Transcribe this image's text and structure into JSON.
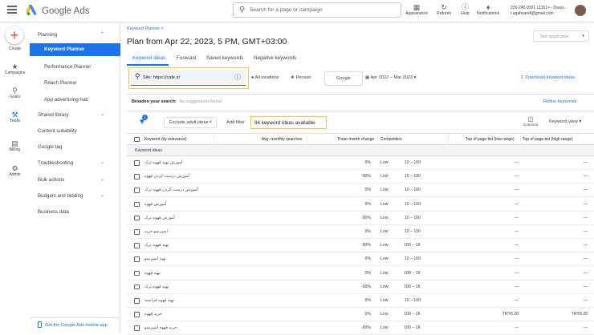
{
  "app": {
    "title": "Google Ads"
  },
  "search": {
    "placeholder": "Search for a page or campaign"
  },
  "toolbar": {
    "appearance": "Appearance",
    "refresh": "Refresh",
    "help": "Help",
    "notifications": "Notifications"
  },
  "account": {
    "id": "226-245-9321 L1151+ - Darex...",
    "email": "t.aqahvandi@gmail.com"
  },
  "rail": {
    "create": "Create",
    "campaigns": "Campaigns",
    "goals": "Goals",
    "tools": "Tools",
    "billing": "Billing",
    "admin": "Admin"
  },
  "sidebar": {
    "planning": "Planning",
    "keyword_planner": "Keyword Planner",
    "performance_planner": "Performance Planner",
    "reach_planner": "Reach Planner",
    "app_advertising_hub": "App advertising hub",
    "shared_library": "Shared library",
    "content_suitability": "Content suitability",
    "google_tag": "Google tag",
    "troubleshooting": "Troubleshooting",
    "bulk_actions": "Bulk actions",
    "budgets_and_bidding": "Budgets and bidding",
    "business_data": "Business data",
    "mobile_app": "Get the Google Ads mobile app"
  },
  "page": {
    "breadcrumb": "Keyword Planner >",
    "title": "Plan from Apr 22, 2023, 5 PM, GMT+03:00",
    "not_applicable": "Not applicable"
  },
  "tabs": {
    "keyword_ideas": "Keyword ideas",
    "forecast": "Forecast",
    "saved_keywords": "Saved keywords",
    "negative_keywords": "Negative keywords"
  },
  "filters": {
    "site": "Site: https://cafe.ir/",
    "locations": "All locations",
    "language": "Persian",
    "network": "Google",
    "date_range": "Apr 2022 – Mar 2023",
    "download": "Download keyword ideas"
  },
  "broaden": {
    "label": "Broaden your search:",
    "value": "No suggestions found",
    "refine": "Refine keywords"
  },
  "tablebar": {
    "filter_count": "1",
    "exclude_chip": "Exclude adult ideas",
    "add_filter": "Add filter",
    "available": "94 keyword ideas available",
    "columns": "Columns",
    "keyword_view": "Keyword view"
  },
  "table": {
    "headers": {
      "keyword": "Keyword (by relevance)",
      "searches": "Avg. monthly searches",
      "change": "Three month change",
      "competition": "Competition",
      "bid_low": "Top of page bid (low range)",
      "bid_high": "Top of page bid (high range)"
    },
    "group": "Keyword ideas",
    "rows": [
      {
        "kw": "آموزش تهیه قهوه ترک",
        "s": "10 – 100",
        "c": "0%",
        "comp": "Low",
        "lo": "—",
        "hi": "—"
      },
      {
        "kw": "آموزش درست کردن قهوه",
        "s": "10 – 100",
        "c": "-90%",
        "comp": "Low",
        "lo": "—",
        "hi": "—"
      },
      {
        "kw": "آموزش درست کردن قهوه ترک",
        "s": "10 – 100",
        "c": "0%",
        "comp": "Low",
        "lo": "—",
        "hi": "—"
      },
      {
        "kw": "آموزش قهوه",
        "s": "10 – 100",
        "c": "0%",
        "comp": "Low",
        "lo": "—",
        "hi": "—"
      },
      {
        "kw": "آموزش قهوه ترک",
        "s": "10 – 100",
        "c": "-90%",
        "comp": "Low",
        "lo": "—",
        "hi": "—"
      },
      {
        "kw": "اسپرسو خرید",
        "s": "10 – 100",
        "c": "0%",
        "comp": "Low",
        "lo": "—",
        "hi": "—"
      },
      {
        "kw": "تهیه قهوه ترک",
        "s": "100 – 1K",
        "c": "-90%",
        "comp": "Low",
        "lo": "—",
        "hi": "—"
      },
      {
        "kw": "تهیه اسپرسو",
        "s": "10 – 100",
        "c": "0%",
        "comp": "Low",
        "lo": "—",
        "hi": "—"
      },
      {
        "kw": "تهیه قهوه",
        "s": "100 – 1K",
        "c": "0%",
        "comp": "Low",
        "lo": "—",
        "hi": "—"
      },
      {
        "kw": "تهیه قهوه ترک",
        "s": "100 – 1K",
        "c": "-90%",
        "comp": "Low",
        "lo": "—",
        "hi": "—"
      },
      {
        "kw": "تهیه قهوه فرانسه",
        "s": "10 – 100",
        "c": "0%",
        "comp": "Low",
        "lo": "—",
        "hi": "—"
      },
      {
        "kw": "خرید قهوه",
        "s": "100 – 1K",
        "c": "0%",
        "comp": "Low",
        "lo": "TRY8.28",
        "hi": "TRY8.28"
      },
      {
        "kw": "خرید قهوه اسپرسو",
        "s": "100 – 1K",
        "c": "-90%",
        "comp": "Low",
        "lo": "—",
        "hi": "—"
      }
    ]
  }
}
